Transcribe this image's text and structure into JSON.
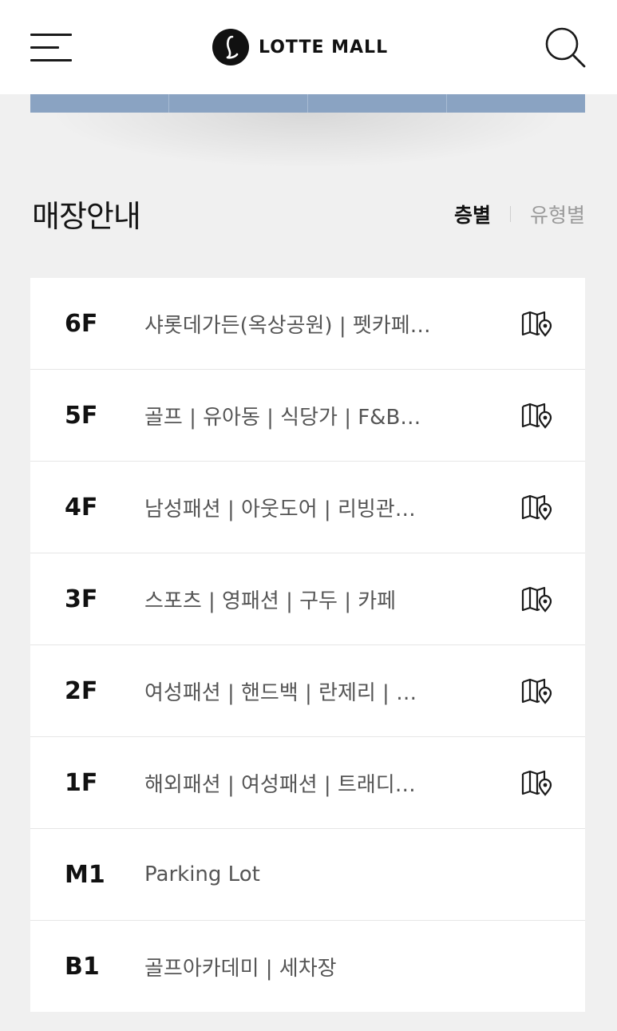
{
  "header": {
    "logo_text": "LOTTE MALL",
    "menu_icon": "hamburger-menu-icon",
    "search_icon": "search-icon"
  },
  "section": {
    "title": "매장안내",
    "tabs": [
      {
        "label": "층별",
        "active": true
      },
      {
        "label": "유형별",
        "active": false
      }
    ]
  },
  "floors": [
    {
      "floor": "6F",
      "desc": "샤롯데가든(옥상공원) | 펫카페…",
      "has_map": true
    },
    {
      "floor": "5F",
      "desc": "골프 | 유아동 | 식당가 | F&B…",
      "has_map": true
    },
    {
      "floor": "4F",
      "desc": "남성패션 | 아웃도어 | 리빙관…",
      "has_map": true
    },
    {
      "floor": "3F",
      "desc": "스포츠 | 영패션 | 구두 | 카페",
      "has_map": true
    },
    {
      "floor": "2F",
      "desc": "여성패션 | 핸드백 | 란제리 | …",
      "has_map": true
    },
    {
      "floor": "1F",
      "desc": "해외패션 | 여성패션 | 트래디…",
      "has_map": true
    },
    {
      "floor": "M1",
      "desc": "Parking Lot",
      "has_map": false
    },
    {
      "floor": "B1",
      "desc": "골프아카데미 | 세차장",
      "has_map": false
    }
  ],
  "colors": {
    "banner_strip": "#8aa3c2",
    "page_bg": "#f0f0f0"
  }
}
